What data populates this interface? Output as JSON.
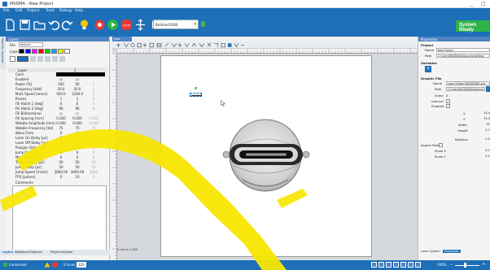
{
  "app": {
    "title": "PRISMA - New Project"
  },
  "window_controls": {
    "minimize": "_",
    "maximize": "□"
  },
  "menu": [
    "File",
    "Edit",
    "Project",
    "Tools",
    "Debug",
    "Help"
  ],
  "toolbar": {
    "board_select": "BoSmart2000",
    "status_label": "System Ready",
    "colors": {
      "stop": "#e53935",
      "green": "#2db34a",
      "yellow": "#f6c700",
      "blue": "#1d6fb8"
    }
  },
  "left_panel": {
    "header": "Layers",
    "file_label": "File",
    "file_value": "last.prt",
    "layer_label": "Layer",
    "layer_colors": [
      "#000000",
      "#0000ff",
      "#ff00ff",
      "#ff0000",
      "#00cc00",
      "#00aaff",
      "#ffff00",
      "#ffffff"
    ],
    "table": {
      "header_name": "Layer",
      "header_value": "1",
      "rows": [
        {
          "name": "Color",
          "v1": "",
          "v2": "",
          "v3": ""
        },
        {
          "name": "Enabled",
          "v1": "☑",
          "v2": "☑",
          "v3": ""
        },
        {
          "name": "Power [%]",
          "v1": "100",
          "v2": "50",
          "v3": "1"
        },
        {
          "name": "Frequency [kHz]",
          "v1": "20.0",
          "v2": "20.0",
          "v3": "2"
        },
        {
          "name": "Mark Speed [mm/s]",
          "v1": "500.0",
          "v2": "1200.0",
          "v3": "3"
        },
        {
          "name": "Passes",
          "v1": "1",
          "v2": "1",
          "v3": "4"
        },
        {
          "name": "Fill Hatch 1 [deg]",
          "v1": "0",
          "v2": "0",
          "v3": "5"
        },
        {
          "name": "Fill Hatch 2 [deg]",
          "v1": "90",
          "v2": "90",
          "v3": "6"
        },
        {
          "name": "Fill Bidirectional",
          "v1": "☑",
          "v2": "☐",
          "v3": ""
        },
        {
          "name": "Fill Spacing [mm]",
          "v1": "0.020",
          "v2": "0.020",
          "v3": "0.050"
        },
        {
          "name": "Wobble Amplitude [mm]",
          "v1": "0.000",
          "v2": "0.000",
          "v3": "0.000"
        },
        {
          "name": "Wobble Frequency [Hz]",
          "v1": "75",
          "v2": "75",
          "v3": "75"
        },
        {
          "name": "Wave Form",
          "v1": "0",
          "v2": "0",
          "v3": "0"
        },
        {
          "name": "Laser On Delay [µs]",
          "v1": "0",
          "v2": "0",
          "v3": "0"
        },
        {
          "name": "Laser Off Delay [µs]",
          "v1": "0",
          "v2": "0",
          "v3": "0"
        },
        {
          "name": "Polygon Delay [µs]",
          "v1": "0",
          "v2": "0",
          "v3": "0"
        },
        {
          "name": "Jump Delay [µs]",
          "v1": "0",
          "v2": "0",
          "v3": "0"
        },
        {
          "name": "Mark Delay [µs]",
          "v1": "0",
          "v2": "0",
          "v3": "0"
        },
        {
          "name": "Trigger Delay [µs]",
          "v1": "50",
          "v2": "50",
          "v3": "50"
        },
        {
          "name": "Jump Delay [µs]",
          "v1": "50",
          "v2": "50",
          "v3": "50"
        },
        {
          "name": "Jump Speed [mm/s]",
          "v1": "3000.00",
          "v2": "3000.00",
          "v3": "3000"
        },
        {
          "name": "FPS [pulses]",
          "v1": "0",
          "v2": "10",
          "v3": "0"
        }
      ]
    },
    "comments_label": "Comments",
    "bottom_tabs": [
      "Layers",
      "Additional Features",
      "Project Explorer"
    ]
  },
  "side_tabs": [
    "Palettes",
    "Explorer"
  ],
  "document": {
    "tab_label": "New Project",
    "coords": "X (mm): 0.000"
  },
  "right_panel": {
    "header": "Properties",
    "project_label": "Project",
    "name_label": "Name",
    "name_value": "New Project",
    "path_label": "Path",
    "path_value": "C:\\Users\\BEGRAVA\\Documents\\New",
    "variables_label": "Variables",
    "graphic_file_label": "Graphic File",
    "gf_name_label": "Name",
    "gf_name_value": "Logo 300dpi ENGRAVING.svg",
    "gf_path_label": "Path",
    "gf_path_value": "C:\\Users\\BEGRAVA\\Desktop\\",
    "index_label": "Index",
    "index_value": "0",
    "internal_label": "Internal",
    "enabled_label": "Enabled",
    "x_label": "X",
    "x_value": "13.4",
    "y_label": "Y",
    "y_value": "79.9",
    "width_label": "Width",
    "width_value": "52",
    "height_label": "Height",
    "height_value": "3.7",
    "rotation_label": "Rotation",
    "rotation_value": "0.0",
    "aspect_label": "Aspect Ratio",
    "scalex_label": "Scale X",
    "scalex_value": "0.1",
    "scaley_label": "Scale Y",
    "scaley_value": "0.1",
    "bottom_tabs": [
      "Laser System",
      "Properties"
    ]
  },
  "status_bar": {
    "connected": "Connected",
    "lines": "0 Lines",
    "count": "320",
    "zoom": "100%"
  }
}
